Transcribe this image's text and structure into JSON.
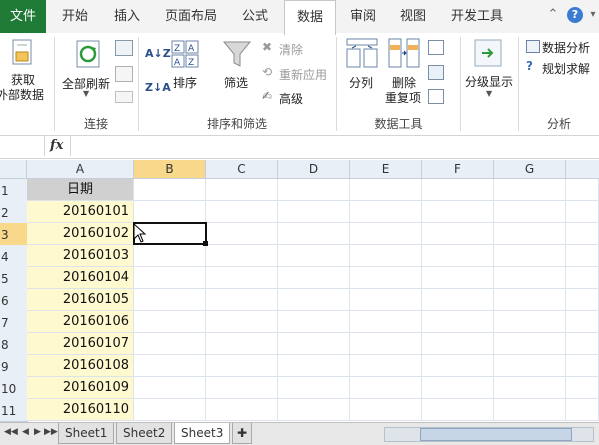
{
  "tabs": {
    "file": "文件",
    "items": [
      "开始",
      "插入",
      "页面布局",
      "公式",
      "数据",
      "审阅",
      "视图",
      "开发工具"
    ],
    "active": "数据",
    "help": "?"
  },
  "ribbon": {
    "get_external": {
      "line1": "获取",
      "line2": "外部数据"
    },
    "connections": {
      "refresh_all": "全部刷新",
      "group": "连接"
    },
    "sort_filter": {
      "sort": "排序",
      "filter": "筛选",
      "clear": "清除",
      "reapply": "重新应用",
      "advanced": "高级",
      "group": "排序和筛选"
    },
    "data_tools": {
      "text_to_columns": "分列",
      "remove_dup_1": "删除",
      "remove_dup_2": "重复项",
      "group": "数据工具"
    },
    "outline": {
      "label": "分级显示"
    },
    "analysis": {
      "data_analysis": "数据分析",
      "solver": "规划求解",
      "group": "分析"
    }
  },
  "formula_bar": {
    "fx": "fx",
    "value": ""
  },
  "grid": {
    "columns": [
      "A",
      "B",
      "C",
      "D",
      "E",
      "F",
      "G"
    ],
    "selected_column": "B",
    "rows": [
      "1",
      "2",
      "3",
      "4",
      "5",
      "6",
      "7",
      "8",
      "9",
      "10",
      "11"
    ],
    "selected_row": "3",
    "colA": [
      "日期",
      "20160101",
      "20160102",
      "20160103",
      "20160104",
      "20160105",
      "20160106",
      "20160107",
      "20160108",
      "20160109",
      "20160110"
    ]
  },
  "sheets": {
    "tabs": [
      "Sheet1",
      "Sheet2",
      "Sheet3"
    ],
    "active": "Sheet3"
  },
  "colors": {
    "excel_green": "#1f7a36",
    "selection_header": "#f8d88a",
    "date_fill": "#fff9d0"
  }
}
